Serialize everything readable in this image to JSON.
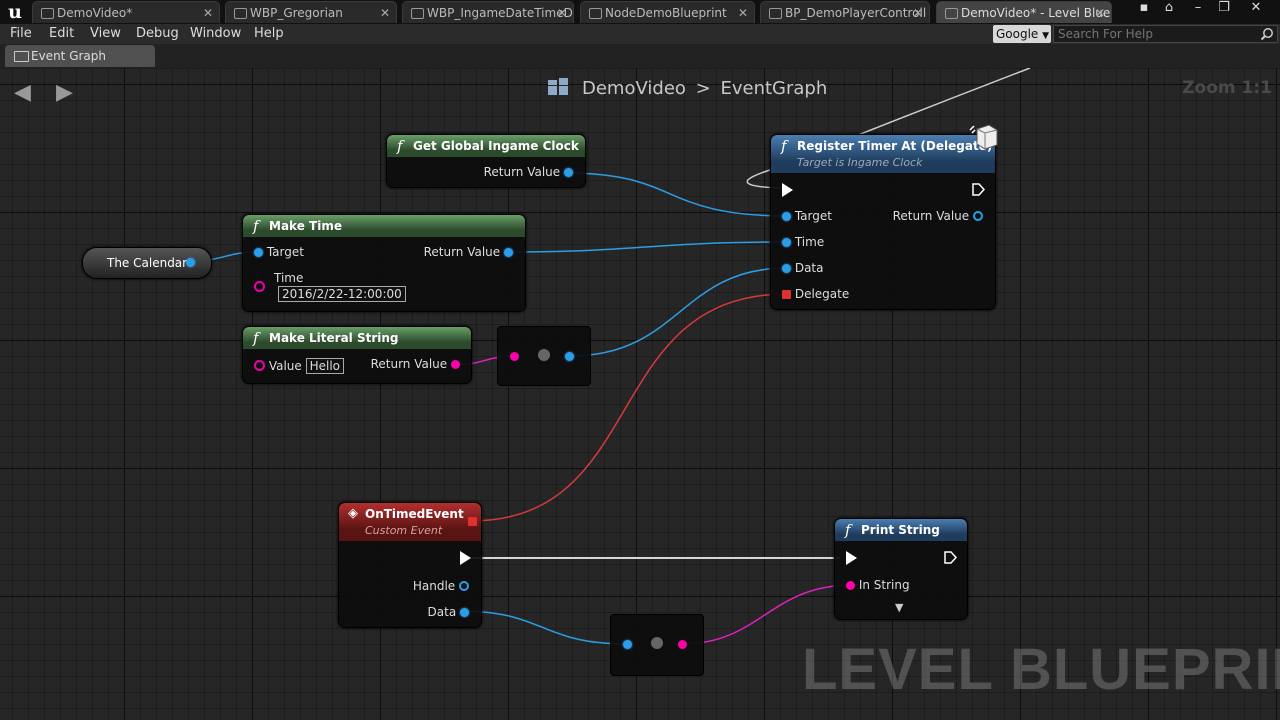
{
  "tabs": [
    {
      "label": "DemoVideo*",
      "active": false
    },
    {
      "label": "WBP_Gregorian",
      "active": false
    },
    {
      "label": "WBP_IngameDateTimeD",
      "active": false
    },
    {
      "label": "NodeDemoBlueprint",
      "active": false
    },
    {
      "label": "BP_DemoPlayerControll",
      "active": false
    },
    {
      "label": "DemoVideo* - Level Blue",
      "active": true
    }
  ],
  "menu": {
    "file": "File",
    "edit": "Edit",
    "view": "View",
    "debug": "Debug",
    "window": "Window",
    "help": "Help"
  },
  "search": {
    "engine": "Google",
    "placeholder": "Search For Help"
  },
  "doc_tab": {
    "label": "Event Graph"
  },
  "breadcrumb": {
    "root": "DemoVideo",
    "separator": ">",
    "leaf": "EventGraph"
  },
  "zoom": "Zoom 1:1",
  "watermark": "LEVEL BLUEPRINT",
  "nodes": {
    "get_clock": {
      "title": "Get Global Ingame Clock",
      "return_value": "Return Value"
    },
    "register_timer": {
      "title": "Register Timer At (Delegate)",
      "subtitle": "Target is Ingame Clock",
      "target": "Target",
      "return_value": "Return Value",
      "time": "Time",
      "data": "Data",
      "delegate": "Delegate"
    },
    "calendar": {
      "label": "The Calendar"
    },
    "make_time": {
      "title": "Make Time",
      "target": "Target",
      "return_value": "Return Value",
      "time_label": "Time",
      "time_value": "2016/2/22-12:00:00"
    },
    "make_literal": {
      "title": "Make Literal String",
      "value_label": "Value",
      "value": "Hello",
      "return_value": "Return Value"
    },
    "on_timed_event": {
      "title": "OnTimedEvent",
      "subtitle": "Custom Event",
      "handle": "Handle",
      "data": "Data"
    },
    "print_string": {
      "title": "Print String",
      "in_string": "In String"
    }
  },
  "colors": {
    "function_header": "#4a7a4a",
    "target_header": "#3b6a96",
    "event_header": "#9a2020",
    "object_wire": "#2a9fe6",
    "string_wire": "#e020c0",
    "delegate_wire": "#d83a3a",
    "exec_wire": "#dddddd"
  }
}
